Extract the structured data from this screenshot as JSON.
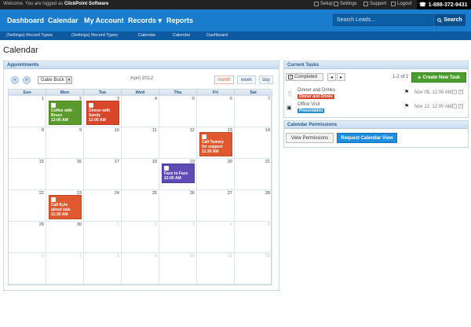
{
  "topbar": {
    "welcome_prefix": "Welcome. You are logged as",
    "welcome_company": "ClickPoint Software",
    "links": [
      "Setup",
      "Settings",
      "Support",
      "Logout"
    ],
    "phone": "1-888-372-9431"
  },
  "nav": {
    "items": [
      "Dashboard",
      "Calendar",
      "My Account",
      "Records",
      "Reports"
    ],
    "records_caret": "▾",
    "search_placeholder": "Search Leads...",
    "search_button": "Search"
  },
  "breadcrumbs": [
    "(Settings) Record Types",
    "(Settings) Record Types",
    "Calendar",
    "Calendar",
    "Dashboard"
  ],
  "page_title": "Calendar",
  "appointments": {
    "title": "Appointments",
    "prev": "«",
    "next": "»",
    "user_select": "Gabe Buck",
    "month_label": "April 2012",
    "views": [
      "month",
      "week",
      "day"
    ],
    "day_headers": [
      "Sun",
      "Mon",
      "Tue",
      "Wed",
      "Thu",
      "Fri",
      "Sat"
    ],
    "weeks": [
      [
        "1",
        "2",
        "3",
        "4",
        "5",
        "6",
        "7"
      ],
      [
        "8",
        "9",
        "10",
        "11",
        "12",
        "13",
        "14"
      ],
      [
        "15",
        "16",
        "17",
        "18",
        "19",
        "20",
        "21"
      ],
      [
        "22",
        "23",
        "24",
        "25",
        "26",
        "27",
        "28"
      ],
      [
        "29",
        "30",
        "1",
        "2",
        "3",
        "4",
        "5"
      ],
      [
        "6",
        "7",
        "8",
        "9",
        "10",
        "11",
        "12"
      ]
    ],
    "events": [
      {
        "title": "Coffee with Bruce",
        "time": "12:00 AM",
        "color": "#5a9a2c"
      },
      {
        "title": "Dinner with Sandy",
        "time": "12:00 AM",
        "color": "#d9472b"
      },
      {
        "title": "Call Tommy for support",
        "time": "11:30 AM",
        "color": "#e0592e"
      },
      {
        "title": "Face to Face",
        "time": "12:00 AM",
        "color": "#5e4bb4"
      },
      {
        "title": "Call Kyle about sale",
        "time": "11:30 AM",
        "color": "#e0592e"
      }
    ]
  },
  "tasks": {
    "title": "Current Tasks",
    "filter": "Completed",
    "pager": "1-2 of 2",
    "new_task": "Create New Task",
    "items": [
      {
        "name": "Dinner and Drinks",
        "badge": "Dinner and Drinks",
        "badge_color": "#d9472b",
        "date": "Nov 05, 12:00 AM"
      },
      {
        "name": "Office Visit",
        "badge": "Presentation",
        "badge_color": "#2a8fd1",
        "date": "Nov 12, 12:00 AM"
      }
    ]
  },
  "permissions": {
    "title": "Calendar Permissions",
    "view_button": "View Permissions",
    "request_button": "Request Calendar View"
  }
}
